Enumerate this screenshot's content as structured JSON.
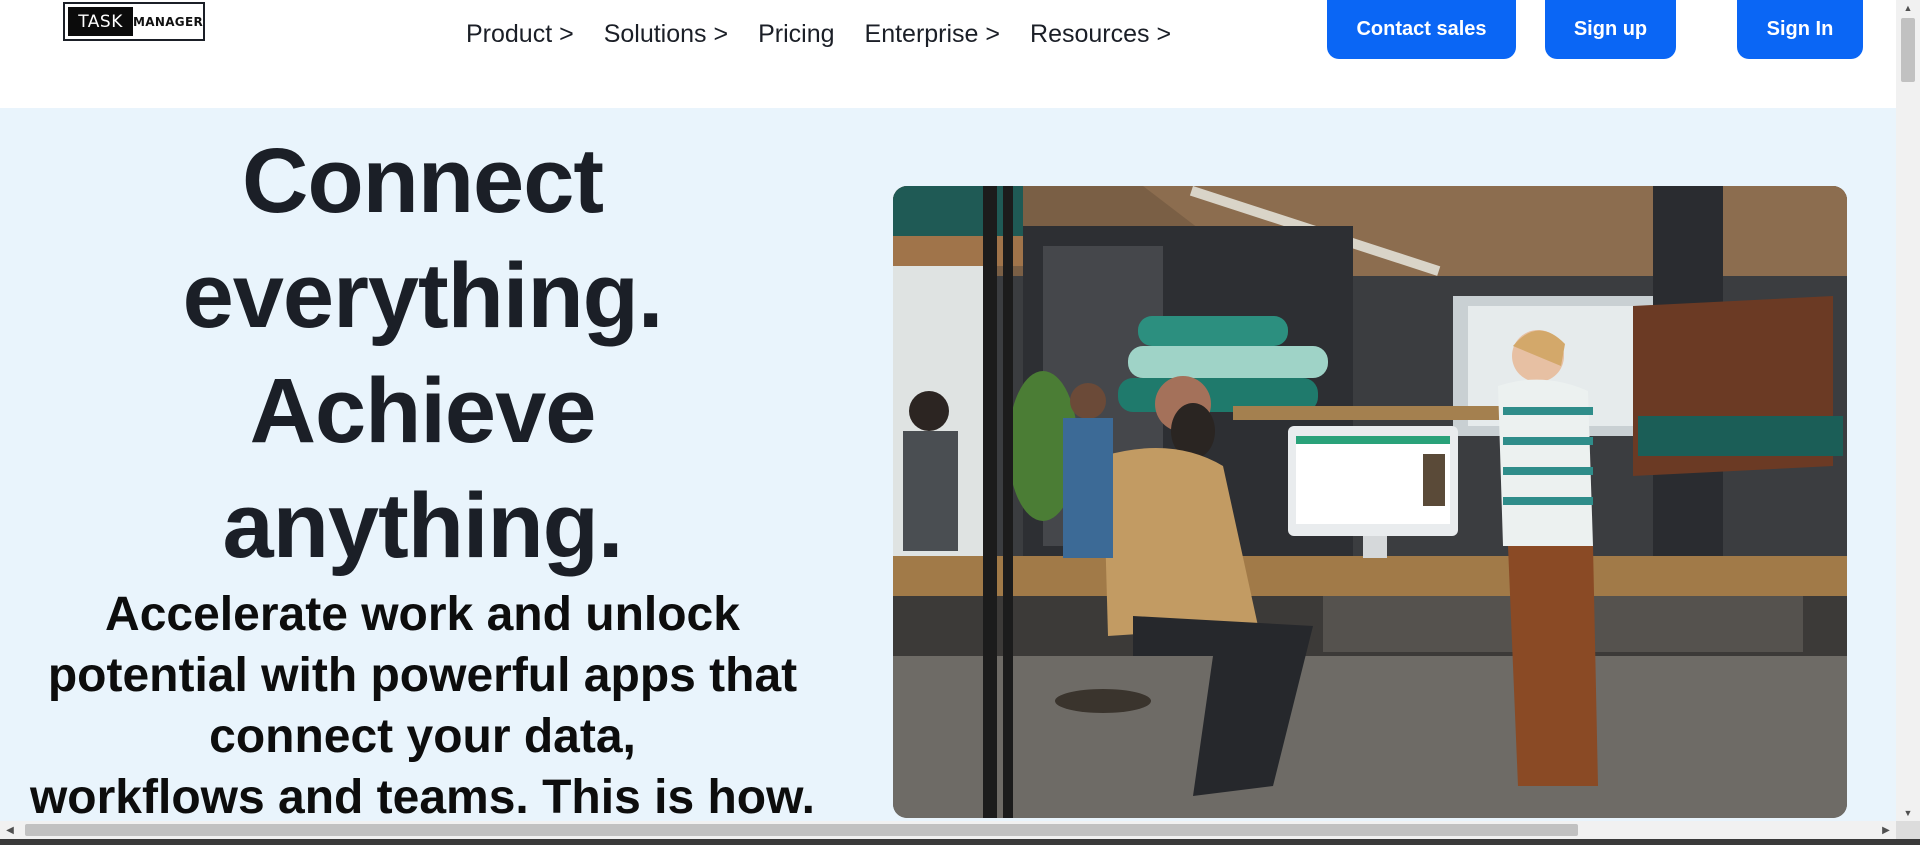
{
  "header": {
    "logo": {
      "left_text": "TASK",
      "right_text": "MANAGER"
    },
    "nav": [
      {
        "label": "Product >"
      },
      {
        "label": "Solutions >"
      },
      {
        "label": "Pricing"
      },
      {
        "label": "Enterprise >"
      },
      {
        "label": "Resources >"
      }
    ],
    "buttons": {
      "contact_sales": "Contact sales",
      "sign_up": "Sign up",
      "sign_in": "Sign In"
    }
  },
  "hero": {
    "title_lines": [
      "Connect",
      "everything.",
      "Achieve",
      "anything."
    ],
    "subtitle_lines": [
      "Accelerate work and unlock",
      "potential with powerful apps that",
      "connect your data,",
      "workflows and teams. This is how."
    ]
  },
  "scrollbars": {
    "up_arrow": "▲",
    "down_arrow": "▼",
    "left_arrow": "◀",
    "right_arrow": "▶"
  },
  "colors": {
    "brand_blue": "#0a66f5",
    "hero_background": "#e9f4fc",
    "text_dark": "#1b1f27"
  }
}
